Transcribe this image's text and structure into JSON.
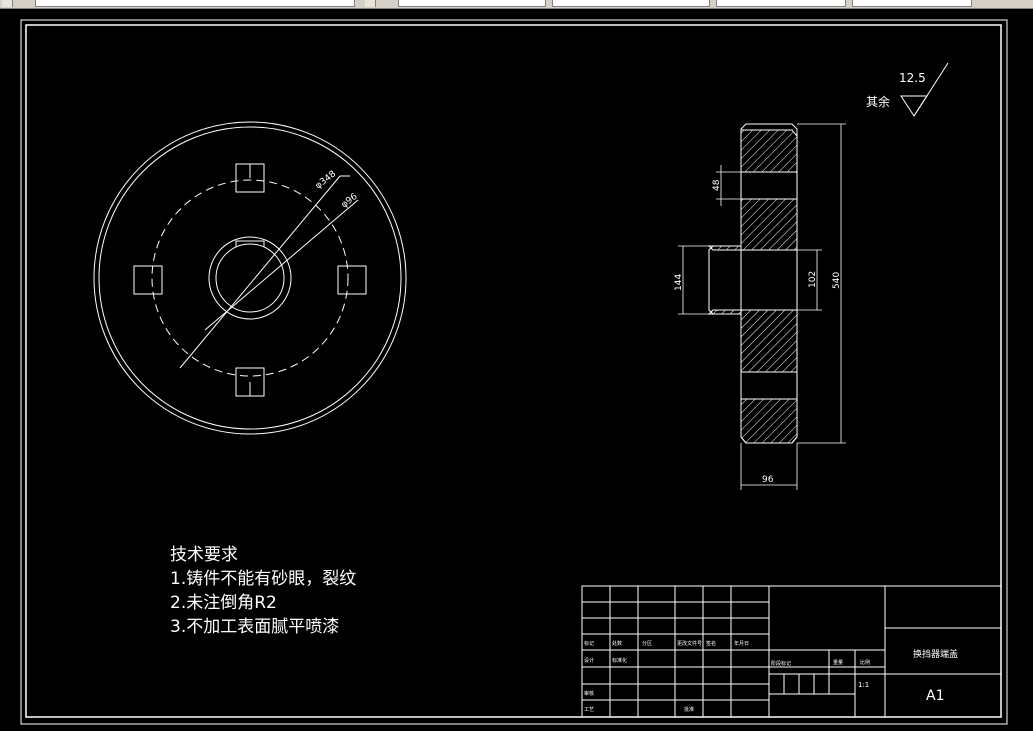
{
  "roughness": {
    "value": "12.5",
    "label": "其余"
  },
  "tech_requirements": {
    "title": "技术要求",
    "items": [
      "1.铸件不能有砂眼，裂纹",
      "2.未注倒角R2",
      "3.不加工表面腻平喷漆"
    ]
  },
  "front_view": {
    "dim_outer": "φ348",
    "dim_pitch": "φ96"
  },
  "section_view": {
    "dim_slot": "48",
    "dim_hub_outer": "144",
    "dim_bore": "102",
    "dim_total": "540",
    "dim_width": "96"
  },
  "title_block": {
    "part_name": "换挡器端盖",
    "paper_size": "A1",
    "scale": "1:1",
    "row_labels": [
      "标记",
      "设计",
      "审核",
      "工艺"
    ],
    "col_labels": [
      "处数",
      "分区",
      "更改文件号",
      "签名",
      "年月日"
    ],
    "small_labels": [
      "标准化",
      "阶段标记",
      "重量",
      "比例",
      "批准"
    ]
  },
  "colors": {
    "background": "#000000",
    "lines": "#ffffff",
    "toolbar": "#d4d0c8"
  }
}
